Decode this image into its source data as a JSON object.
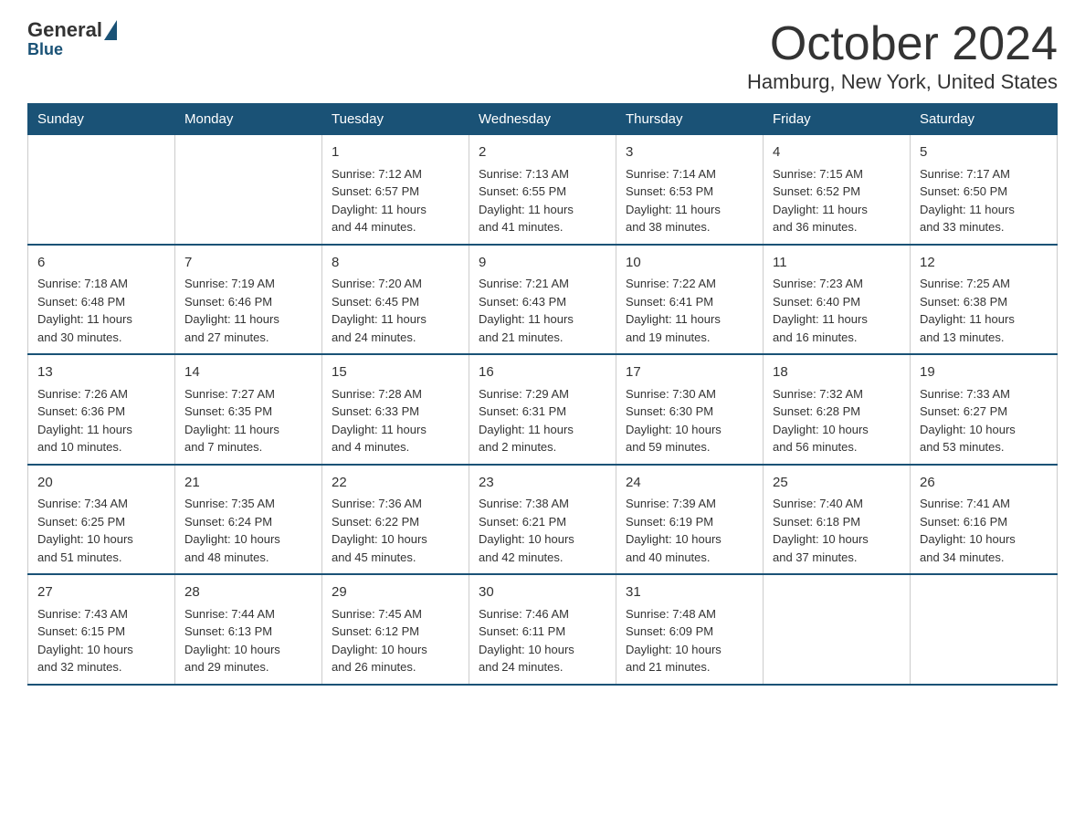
{
  "logo": {
    "general": "General",
    "blue": "Blue"
  },
  "title": "October 2024",
  "subtitle": "Hamburg, New York, United States",
  "days_header": [
    "Sunday",
    "Monday",
    "Tuesday",
    "Wednesday",
    "Thursday",
    "Friday",
    "Saturday"
  ],
  "weeks": [
    [
      {
        "day": "",
        "info": ""
      },
      {
        "day": "",
        "info": ""
      },
      {
        "day": "1",
        "info": "Sunrise: 7:12 AM\nSunset: 6:57 PM\nDaylight: 11 hours\nand 44 minutes."
      },
      {
        "day": "2",
        "info": "Sunrise: 7:13 AM\nSunset: 6:55 PM\nDaylight: 11 hours\nand 41 minutes."
      },
      {
        "day": "3",
        "info": "Sunrise: 7:14 AM\nSunset: 6:53 PM\nDaylight: 11 hours\nand 38 minutes."
      },
      {
        "day": "4",
        "info": "Sunrise: 7:15 AM\nSunset: 6:52 PM\nDaylight: 11 hours\nand 36 minutes."
      },
      {
        "day": "5",
        "info": "Sunrise: 7:17 AM\nSunset: 6:50 PM\nDaylight: 11 hours\nand 33 minutes."
      }
    ],
    [
      {
        "day": "6",
        "info": "Sunrise: 7:18 AM\nSunset: 6:48 PM\nDaylight: 11 hours\nand 30 minutes."
      },
      {
        "day": "7",
        "info": "Sunrise: 7:19 AM\nSunset: 6:46 PM\nDaylight: 11 hours\nand 27 minutes."
      },
      {
        "day": "8",
        "info": "Sunrise: 7:20 AM\nSunset: 6:45 PM\nDaylight: 11 hours\nand 24 minutes."
      },
      {
        "day": "9",
        "info": "Sunrise: 7:21 AM\nSunset: 6:43 PM\nDaylight: 11 hours\nand 21 minutes."
      },
      {
        "day": "10",
        "info": "Sunrise: 7:22 AM\nSunset: 6:41 PM\nDaylight: 11 hours\nand 19 minutes."
      },
      {
        "day": "11",
        "info": "Sunrise: 7:23 AM\nSunset: 6:40 PM\nDaylight: 11 hours\nand 16 minutes."
      },
      {
        "day": "12",
        "info": "Sunrise: 7:25 AM\nSunset: 6:38 PM\nDaylight: 11 hours\nand 13 minutes."
      }
    ],
    [
      {
        "day": "13",
        "info": "Sunrise: 7:26 AM\nSunset: 6:36 PM\nDaylight: 11 hours\nand 10 minutes."
      },
      {
        "day": "14",
        "info": "Sunrise: 7:27 AM\nSunset: 6:35 PM\nDaylight: 11 hours\nand 7 minutes."
      },
      {
        "day": "15",
        "info": "Sunrise: 7:28 AM\nSunset: 6:33 PM\nDaylight: 11 hours\nand 4 minutes."
      },
      {
        "day": "16",
        "info": "Sunrise: 7:29 AM\nSunset: 6:31 PM\nDaylight: 11 hours\nand 2 minutes."
      },
      {
        "day": "17",
        "info": "Sunrise: 7:30 AM\nSunset: 6:30 PM\nDaylight: 10 hours\nand 59 minutes."
      },
      {
        "day": "18",
        "info": "Sunrise: 7:32 AM\nSunset: 6:28 PM\nDaylight: 10 hours\nand 56 minutes."
      },
      {
        "day": "19",
        "info": "Sunrise: 7:33 AM\nSunset: 6:27 PM\nDaylight: 10 hours\nand 53 minutes."
      }
    ],
    [
      {
        "day": "20",
        "info": "Sunrise: 7:34 AM\nSunset: 6:25 PM\nDaylight: 10 hours\nand 51 minutes."
      },
      {
        "day": "21",
        "info": "Sunrise: 7:35 AM\nSunset: 6:24 PM\nDaylight: 10 hours\nand 48 minutes."
      },
      {
        "day": "22",
        "info": "Sunrise: 7:36 AM\nSunset: 6:22 PM\nDaylight: 10 hours\nand 45 minutes."
      },
      {
        "day": "23",
        "info": "Sunrise: 7:38 AM\nSunset: 6:21 PM\nDaylight: 10 hours\nand 42 minutes."
      },
      {
        "day": "24",
        "info": "Sunrise: 7:39 AM\nSunset: 6:19 PM\nDaylight: 10 hours\nand 40 minutes."
      },
      {
        "day": "25",
        "info": "Sunrise: 7:40 AM\nSunset: 6:18 PM\nDaylight: 10 hours\nand 37 minutes."
      },
      {
        "day": "26",
        "info": "Sunrise: 7:41 AM\nSunset: 6:16 PM\nDaylight: 10 hours\nand 34 minutes."
      }
    ],
    [
      {
        "day": "27",
        "info": "Sunrise: 7:43 AM\nSunset: 6:15 PM\nDaylight: 10 hours\nand 32 minutes."
      },
      {
        "day": "28",
        "info": "Sunrise: 7:44 AM\nSunset: 6:13 PM\nDaylight: 10 hours\nand 29 minutes."
      },
      {
        "day": "29",
        "info": "Sunrise: 7:45 AM\nSunset: 6:12 PM\nDaylight: 10 hours\nand 26 minutes."
      },
      {
        "day": "30",
        "info": "Sunrise: 7:46 AM\nSunset: 6:11 PM\nDaylight: 10 hours\nand 24 minutes."
      },
      {
        "day": "31",
        "info": "Sunrise: 7:48 AM\nSunset: 6:09 PM\nDaylight: 10 hours\nand 21 minutes."
      },
      {
        "day": "",
        "info": ""
      },
      {
        "day": "",
        "info": ""
      }
    ]
  ]
}
